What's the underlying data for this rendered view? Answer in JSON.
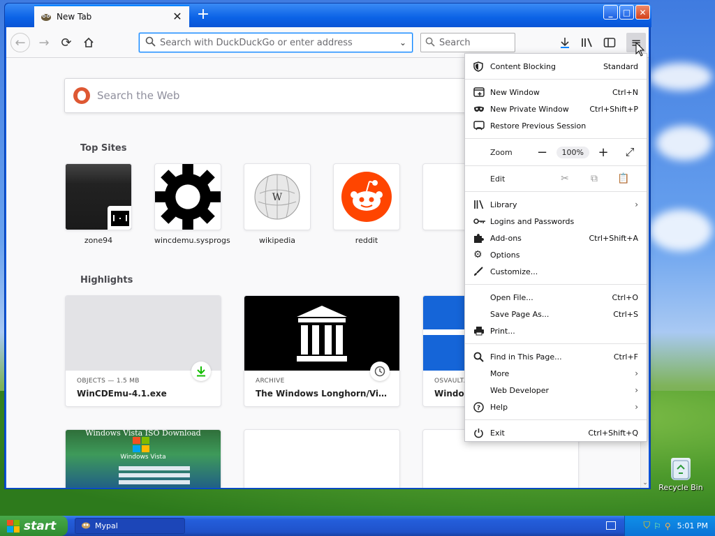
{
  "browser": {
    "tab_title": "New Tab",
    "url_placeholder": "Search with DuckDuckGo or enter address",
    "search_placeholder": "Search"
  },
  "newtab": {
    "web_search_placeholder": "Search the Web",
    "top_sites_title": "Top Sites",
    "top_sites": [
      {
        "label": "zone94"
      },
      {
        "label": "wincdemu.sysprogs"
      },
      {
        "label": "wikipedia"
      },
      {
        "label": "reddit"
      }
    ],
    "highlights_title": "Highlights",
    "highlights": [
      {
        "category": "OBJECTS — 1.5 MB",
        "title": "WinCDEmu-4.1.exe"
      },
      {
        "category": "ARCHIVE",
        "title": "The Windows Longhorn/Vista Ar..."
      },
      {
        "category": "OSVAULT.",
        "title": "Window"
      }
    ],
    "highlight_thumb_text": "Windows Vista ISO Download",
    "highlight_thumb_logo": "Windows Vista"
  },
  "menu": {
    "content_blocking": {
      "label": "Content Blocking",
      "value": "Standard"
    },
    "new_window": {
      "label": "New Window",
      "shortcut": "Ctrl+N"
    },
    "new_private_window": {
      "label": "New Private Window",
      "shortcut": "Ctrl+Shift+P"
    },
    "restore_session": {
      "label": "Restore Previous Session"
    },
    "zoom": {
      "label": "Zoom",
      "value": "100%"
    },
    "edit": {
      "label": "Edit"
    },
    "library": {
      "label": "Library"
    },
    "logins": {
      "label": "Logins and Passwords"
    },
    "addons": {
      "label": "Add-ons",
      "shortcut": "Ctrl+Shift+A"
    },
    "options": {
      "label": "Options"
    },
    "customize": {
      "label": "Customize..."
    },
    "open_file": {
      "label": "Open File...",
      "shortcut": "Ctrl+O"
    },
    "save_page": {
      "label": "Save Page As...",
      "shortcut": "Ctrl+S"
    },
    "print": {
      "label": "Print..."
    },
    "find": {
      "label": "Find in This Page...",
      "shortcut": "Ctrl+F"
    },
    "more": {
      "label": "More"
    },
    "web_developer": {
      "label": "Web Developer"
    },
    "help": {
      "label": "Help"
    },
    "exit": {
      "label": "Exit",
      "shortcut": "Ctrl+Shift+Q"
    }
  },
  "desktop": {
    "recycle_bin": "Recycle Bin"
  },
  "taskbar": {
    "start_label": "start",
    "task_label": "Mypal",
    "clock": "5:01 PM"
  },
  "colors": {
    "accent": "#0a84ff",
    "download_green": "#12bc00",
    "reddit": "#ff4500"
  }
}
